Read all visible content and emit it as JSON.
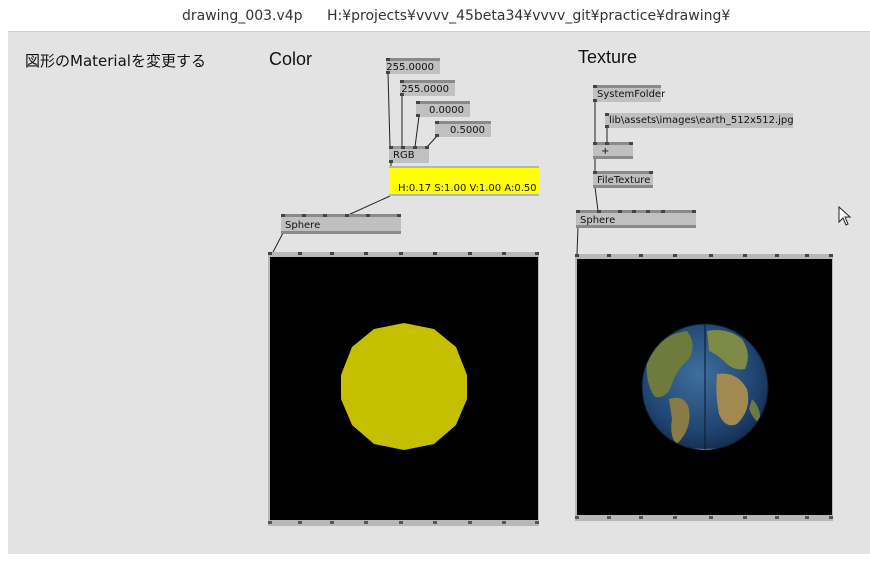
{
  "window": {
    "file_name": "drawing_003.v4p",
    "path": "H:¥projects¥vvvv_45beta34¥vvvv_git¥practice¥drawing¥"
  },
  "comment": "図形のMaterialを変更する",
  "color_section": {
    "heading": "Color",
    "iobox_1": "255.0000",
    "iobox_2": "255.0000",
    "iobox_3": "0.0000",
    "iobox_4": "0.5000",
    "rgb_node": "RGB",
    "color_readout": "H:0.17  S:1.00  V:1.00  A:0.50",
    "color_value": "#ffff00",
    "sphere_node": "Sphere",
    "sphere_render_color": "#c4c000"
  },
  "texture_section": {
    "heading": "Texture",
    "systemfolder_node": "SystemFolder",
    "path_iobox": "lib\\assets\\images\\earth_512x512.jpg",
    "add_node": "+",
    "filetexture_node": "FileTexture",
    "sphere_node": "Sphere"
  }
}
